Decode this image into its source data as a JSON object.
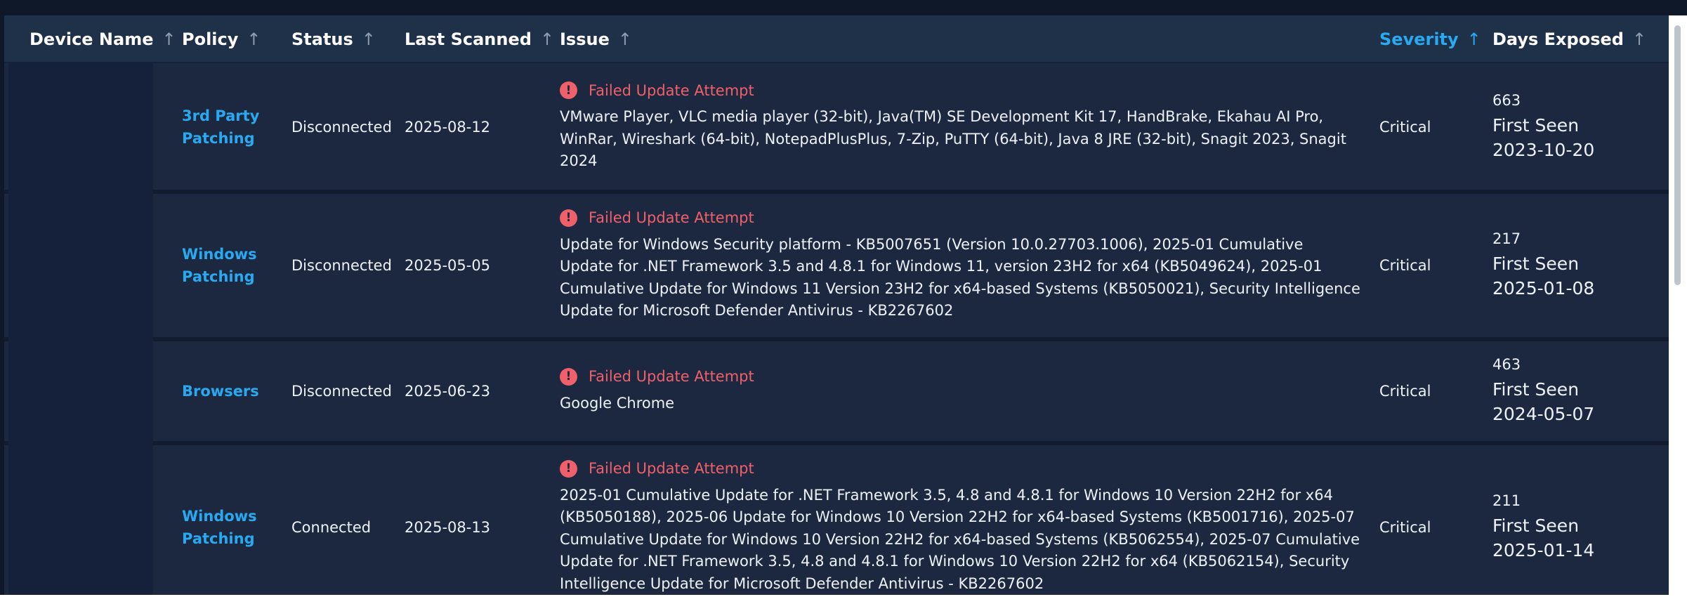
{
  "columns": [
    {
      "label": "Device Name",
      "active": false
    },
    {
      "label": "Policy",
      "active": false
    },
    {
      "label": "Status",
      "active": false
    },
    {
      "label": "Last Scanned",
      "active": false
    },
    {
      "label": "Issue",
      "active": false
    },
    {
      "label": "Severity",
      "active": true
    },
    {
      "label": "Days Exposed",
      "active": false
    }
  ],
  "sort_icon": "arrow-up-icon",
  "alert_icon": "alert-circle-icon",
  "colors": {
    "accent": "#28a9f0",
    "danger": "#f0606a",
    "background": "#1b283f",
    "header": "#1f3049"
  },
  "rows": [
    {
      "policy": "3rd Party Patching",
      "status": "Disconnected",
      "last_scanned": "2025-08-12",
      "issue_title": "Failed Update Attempt",
      "issue_text": "VMware Player, VLC media player (32-bit), Java(TM) SE Development Kit 17, HandBrake, Ekahau AI Pro, WinRar, Wireshark (64-bit), NotepadPlusPlus, 7-Zip, PuTTY (64-bit), Java 8 JRE (32-bit), Snagit 2023, Snagit 2024",
      "severity": "Critical",
      "days": "663",
      "first_seen": "First Seen 2023-10-20"
    },
    {
      "policy": "Windows Patching",
      "status": "Disconnected",
      "last_scanned": "2025-05-05",
      "issue_title": "Failed Update Attempt",
      "issue_text": "Update for Windows Security platform - KB5007651 (Version 10.0.27703.1006), 2025-01 Cumulative Update for .NET Framework 3.5 and 4.8.1 for Windows 11, version 23H2 for x64 (KB5049624), 2025-01 Cumulative Update for Windows 11 Version 23H2 for x64-based Systems (KB5050021), Security Intelligence Update for Microsoft Defender Antivirus - KB2267602",
      "severity": "Critical",
      "days": "217",
      "first_seen": "First Seen 2025-01-08"
    },
    {
      "policy": "Browsers",
      "status": "Disconnected",
      "last_scanned": "2025-06-23",
      "issue_title": "Failed Update Attempt",
      "issue_text": "Google Chrome",
      "severity": "Critical",
      "days": "463",
      "first_seen": "First Seen 2024-05-07"
    },
    {
      "policy": "Windows Patching",
      "status": "Connected",
      "last_scanned": "2025-08-13",
      "issue_title": "Failed Update Attempt",
      "issue_text": "2025-01 Cumulative Update for .NET Framework 3.5, 4.8 and 4.8.1 for Windows 10 Version 22H2 for x64 (KB5050188), 2025-06 Update for Windows 10 Version 22H2 for x64-based Systems (KB5001716), 2025-07 Cumulative Update for Windows 10 Version 22H2 for x64-based Systems (KB5062554), 2025-07 Cumulative Update for .NET Framework 3.5, 4.8 and 4.8.1 for Windows 10 Version 22H2 for x64 (KB5062154), Security Intelligence Update for Microsoft Defender Antivirus - KB2267602",
      "severity": "Critical",
      "days": "211",
      "first_seen": "First Seen 2025-01-14"
    }
  ]
}
